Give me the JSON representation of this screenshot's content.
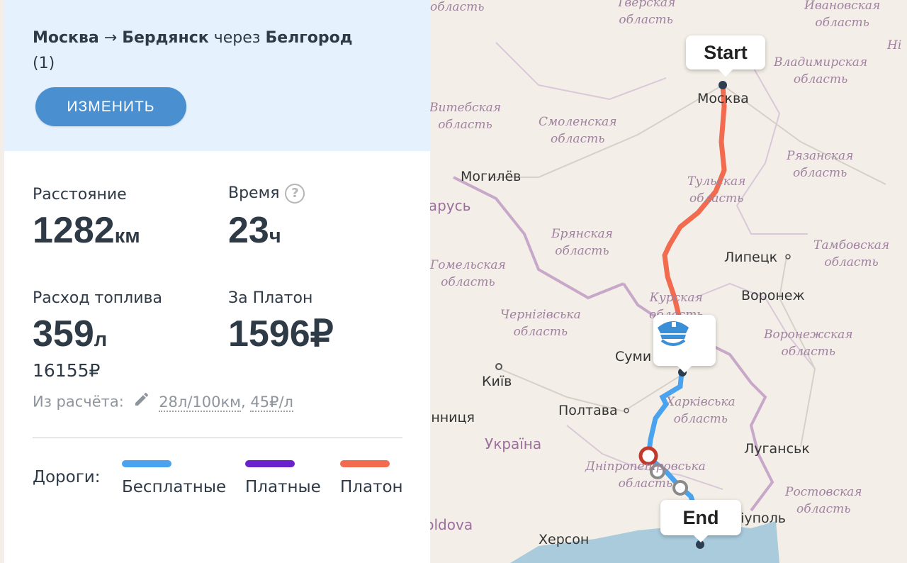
{
  "route": {
    "from": "Москва",
    "arrow": "→",
    "to": "Бердянск",
    "via_word": "через",
    "via": "Белгород",
    "count": "(1)"
  },
  "change_button": "ИЗМЕНИТЬ",
  "stats": {
    "distance_label": "Расстояние",
    "distance_value": "1282",
    "distance_unit": "км",
    "time_label": "Время",
    "time_value": "23",
    "time_unit": "ч",
    "fuel_label": "Расход топлива",
    "fuel_value": "359",
    "fuel_unit": "л",
    "platon_label": "За Платон",
    "platon_value": "1596₽",
    "fuel_cost": "16155₽"
  },
  "calc": {
    "prefix": "Из расчёта:",
    "consumption": "28л/100км",
    "separator": ",",
    "price": "45₽/л"
  },
  "legend": {
    "title": "Дороги:",
    "items": [
      {
        "label": "Бесплатные",
        "color": "#4aa3ee"
      },
      {
        "label": "Платные",
        "color": "#6a22cc"
      },
      {
        "label": "Платон",
        "color": "#f26b4f"
      }
    ]
  },
  "map": {
    "start_label": "Start",
    "end_label": "End",
    "regions": [
      "Тверская\nобласть",
      "Ивановская\nобласть",
      "Владимирская\nобласть",
      "Смоленская\nобласть",
      "Рязанская\nобласть",
      "Тульская\nобласть",
      "Брянская\nобласть",
      "Тамбовская\nобласть",
      "Гомельская\nобласть",
      "Курская\nобласть",
      "Чернігівська\nобласть",
      "Воронежская\nобласть",
      "Харківська\nобласть",
      "Дніпропетровська\nобласть",
      "Ростовская\nобласть",
      "Витебская\nобласть",
      "область",
      "Ні"
    ],
    "cities": [
      "Москва",
      "Могилёв",
      "Липецк",
      "Воронеж",
      "Суми",
      "Київ",
      "Полтава",
      "Луганськ",
      "Херсон",
      "Маріуполь"
    ],
    "countries": [
      "Беларусь",
      "Україна",
      "Moldova",
      "Вінниця"
    ]
  }
}
